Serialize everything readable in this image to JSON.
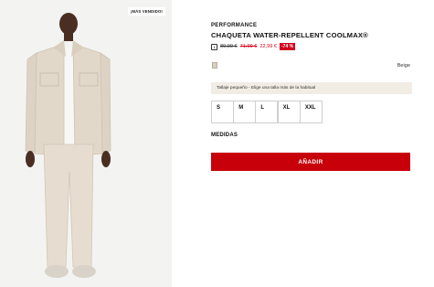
{
  "photo": {
    "badge": "¡MÁS VENDIDO!"
  },
  "product": {
    "eyebrow": "PERFORMANCE",
    "title": "CHAQUETA WATER-REPELLENT COOLMAX®",
    "prices": {
      "original": "89,99 €",
      "previous": "71,99 €",
      "current": "22,99 €",
      "discount": "-74 %"
    },
    "color": {
      "name": "Beige",
      "swatch": "#d8cfc0"
    },
    "fit_notice": "Tallaje pequeño - Elige una talla más de la habitual",
    "sizes": [
      "S",
      "M",
      "L",
      "XL",
      "XXL"
    ],
    "measures_label": "MEDIDAS",
    "add_button": "AÑADIR"
  },
  "colors": {
    "accent": "#c8000a",
    "sale": "#d0021b",
    "banner": "#f1ece4"
  }
}
